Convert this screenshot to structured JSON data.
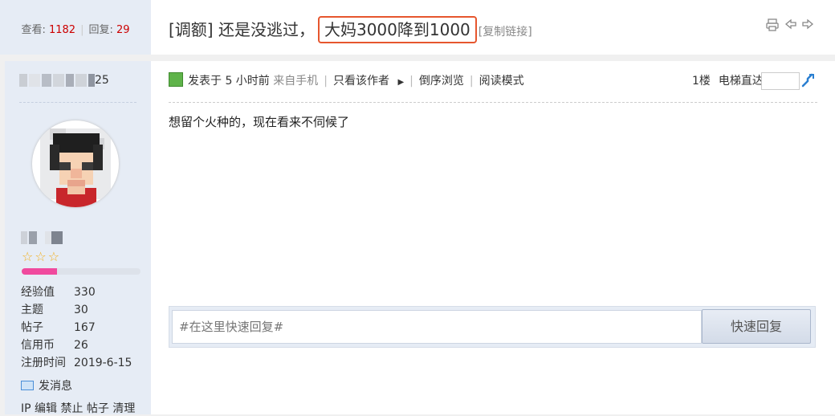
{
  "thread": {
    "views_label": "查看:",
    "views": "1182",
    "replies_label": "回复:",
    "replies": "29",
    "title_prefix": "[调额] 还是没逃过，",
    "title_highlight": "大妈3000降到1000",
    "copy_link": "[复制链接]",
    "icons": [
      "print-icon",
      "prev-thread-icon",
      "next-thread-icon"
    ]
  },
  "author": {
    "username_suffix": "25",
    "stars": "☆☆☆",
    "level_progress": 0.3,
    "stats": [
      {
        "label": "经验值",
        "value": "330"
      },
      {
        "label": "主题",
        "value": "30"
      },
      {
        "label": "帖子",
        "value": "167"
      },
      {
        "label": "信用币",
        "value": "26"
      },
      {
        "label": "注册时间",
        "value": "2019-6-15"
      }
    ],
    "send_message": "发消息",
    "admin_links": "IP 编辑 禁止 帖子 清理"
  },
  "post": {
    "posted": "发表于 5 小时前",
    "source": "来自手机",
    "only_author": "只看该作者",
    "reverse": "倒序浏览",
    "read_mode": "阅读模式",
    "floor": "1楼",
    "jump_label": "电梯直达",
    "body": "想留个火种的，现在看来不伺候了"
  },
  "reply": {
    "placeholder": "#在这里快速回复#",
    "button": "快速回复"
  },
  "colors": {
    "accent_red": "#cc0000",
    "highlight_border": "#e6562e",
    "progress": "#f04a9e",
    "star": "#f2b01e",
    "sidebar_bg": "#e6ecf5"
  }
}
